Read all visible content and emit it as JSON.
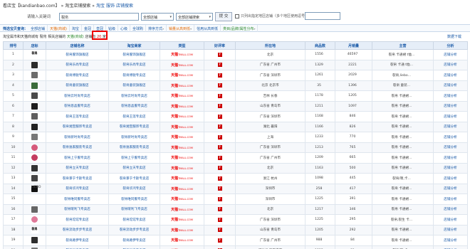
{
  "breadcrumb": {
    "items": [
      "看店宝【kandianbao.com】",
      "»",
      "淘宝店铺搜索",
      "»",
      "淘宝",
      "服饰",
      "店铺搜索"
    ]
  },
  "search": {
    "label": "请输入关键词",
    "value": "裂帛",
    "select1": "全部店铺",
    "select2": "全部店铺搜索",
    "button": "提 交",
    "checkbox_label": "只列出指定地区店铺（多个地区使用逗号 区分）"
  },
  "filter": {
    "title": "筛选宝贝查询：",
    "tabs": [
      {
        "label": "全部店铺",
        "style": "sel-tab"
      },
      {
        "label": "天猫(商城)",
        "style": "orange"
      },
      {
        "label": "淘宝",
        "style": ""
      },
      {
        "label": "金冠",
        "style": ""
      },
      {
        "label": "皇冠",
        "style": ""
      },
      {
        "label": "钻级",
        "style": ""
      },
      {
        "label": "心级",
        "style": ""
      },
      {
        "label": "全球购",
        "style": ""
      },
      {
        "label": "排序方式",
        "style": "",
        "arrow": "▾"
      },
      {
        "label": "销量从高到低",
        "style": "orange",
        "arrow": "▾"
      },
      {
        "label": "信用从高到低",
        "style": ""
      },
      {
        "label": "类目/品牌/属性分布",
        "style": "green",
        "arrow": "▾"
      }
    ]
  },
  "info": {
    "prefix": "淘宝属市和天猫商城有",
    "keyword": "裂帛",
    "mid": "相关店铺",
    "scope_prefix": "的",
    "scope": "天猫(商城)",
    "count_prefix": "店铺有",
    "count": "20",
    "count_suffix": "家"
  },
  "export_label": "数据下载",
  "table": {
    "headers": [
      "排号",
      "店标",
      "店铺名称",
      "淘宝商家",
      "类型",
      "好评率",
      "所在地",
      "商品数",
      "月销量",
      "主营",
      "分析"
    ],
    "rows": [
      {
        "no": "1",
        "logo_text": "裂帛",
        "name": "裂帛服饰旗舰店",
        "seller": "裂帛服饰旗舰店",
        "type": "天猫",
        "type_small": "TMALL.COM",
        "rate": "?",
        "loc": "北京",
        "items": "1556",
        "sales": "46597",
        "main": "裂帛 卡通裙 t恤...",
        "action": "店铺分析"
      },
      {
        "no": "2",
        "logo_text": "",
        "name": "裂帛乐尚专卖店",
        "seller": "裂帛乐尚专卖店",
        "type": "天猫",
        "type_small": "TMALL.COM",
        "rate": "?",
        "loc": "广东省 广州市",
        "items": "1329",
        "sales": "2221",
        "main": "裂帛 卡通 t恤...",
        "action": "店铺分析"
      },
      {
        "no": "3",
        "logo_text": "",
        "name": "裂帛博锐专卖店",
        "seller": "裂帛博锐专卖店",
        "type": "天猫",
        "type_small": "TMALL.COM",
        "rate": "?",
        "loc": "广东省 深圳市",
        "items": "1261",
        "sales": "2029",
        "main": "裂帛,liebo...",
        "action": "店铺分析"
      },
      {
        "no": "4",
        "logo_text": "",
        "name": "裂帛童装旗舰店",
        "seller": "裂帛童装旗舰店",
        "type": "天猫",
        "type_small": "TMALL.COM",
        "rate": "?",
        "loc": "北京 北京市",
        "items": "35",
        "sales": "1396",
        "main": "裂帛 童装...",
        "action": "店铺分析"
      },
      {
        "no": "5",
        "logo_text": "",
        "name": "裂帛云时尚专卖店",
        "seller": "裂帛云时尚专卖店",
        "type": "天猫",
        "type_small": "TMALL.COM",
        "rate": "?",
        "loc": "吉林 长春",
        "items": "1178",
        "sales": "1205",
        "main": "裂帛 卡通裙...",
        "action": "店铺分析"
      },
      {
        "no": "6",
        "logo_text": "",
        "name": "裂帛恩晶服专卖店",
        "seller": "裂帛恩晶服专卖店",
        "type": "天猫",
        "type_small": "TMALL.COM",
        "rate": "?",
        "loc": "山东省 青岛市",
        "items": "1211",
        "sales": "1097",
        "main": "裂帛 卡通裙...",
        "action": "店铺分析"
      },
      {
        "no": "7",
        "logo_text": "",
        "name": "裂帛王莲专卖店",
        "seller": "裂帛王莲专卖店",
        "type": "天猫",
        "type_small": "TMALL.COM",
        "rate": "?",
        "loc": "广东省 深圳市",
        "items": "1168",
        "sales": "846",
        "main": "裂帛 卡通裙...",
        "action": "店铺分析"
      },
      {
        "no": "8",
        "logo_text": "",
        "name": "裂帛湘宝服饰专卖店",
        "seller": "裂帛湘宝服饰专卖店",
        "type": "天猫",
        "type_small": "TMALL.COM",
        "rate": "?",
        "loc": "湖北 襄阳",
        "items": "1166",
        "sales": "826",
        "main": "裂帛 卡通裙...",
        "action": "店铺分析"
      },
      {
        "no": "9",
        "logo_text": "",
        "name": "裂帛新时尚专卖店",
        "seller": "裂帛新时尚专卖店",
        "type": "天猫",
        "type_small": "TMALL.COM",
        "rate": "?",
        "loc": "上海",
        "items": "1233",
        "sales": "770",
        "main": "裂帛 卡通裙...",
        "action": "店铺分析"
      },
      {
        "no": "10",
        "logo_text": "",
        "name": "裂帛逸家服装专卖店",
        "seller": "裂帛逸家服装专卖店",
        "type": "天猫",
        "type_small": "TMALL.COM",
        "rate": "?",
        "loc": "广东省 深圳市",
        "items": "1213",
        "sales": "765",
        "main": "裂帛 卡通裙...",
        "action": "店铺分析"
      },
      {
        "no": "11",
        "logo_text": "",
        "name": "裂帛上宁服专卖店",
        "seller": "裂帛上宁服专卖店",
        "type": "天猫",
        "type_small": "TMALL.COM",
        "rate": "?",
        "loc": "广东省 广州市",
        "items": "1209",
        "sales": "665",
        "main": "裂帛 卡通裙...",
        "action": "店铺分析"
      },
      {
        "no": "12",
        "logo_text": "",
        "name": "裂帛立天专卖店",
        "seller": "裂帛立天专卖店",
        "type": "天猫",
        "type_small": "TMALL.COM",
        "rate": "?",
        "loc": "北京",
        "items": "1163",
        "sales": "500",
        "main": "裂帛 卡通裙...",
        "action": "店铺分析"
      },
      {
        "no": "13",
        "logo_text": "",
        "name": "裂帛掌于卡斯专卖店",
        "seller": "裂帛掌于卡斯专卖店",
        "type": "天猫",
        "type_small": "TMALL.COM",
        "rate": "?",
        "loc": "浙江 杭州",
        "items": "1098",
        "sales": "445",
        "main": "裂帛/唛,卡...",
        "action": "店铺分析"
      },
      {
        "no": "14",
        "logo_text": "LIEBO",
        "name": "裂帛华鸿专卖店",
        "seller": "裂帛华鸿专卖店",
        "type": "天猫",
        "type_small": "TMALL.COM",
        "rate": "?",
        "loc": "深圳市",
        "items": "258",
        "sales": "417",
        "main": "裂帛 卡通裙...",
        "action": "店铺分析"
      },
      {
        "no": "15",
        "logo_text": "",
        "name": "裂帛唯同服专卖店",
        "seller": "裂帛唯同服专卖店",
        "type": "天猫",
        "type_small": "TMALL.COM",
        "rate": "?",
        "loc": "深圳市",
        "items": "1225",
        "sales": "391",
        "main": "裂帛 卡通裙...",
        "action": "店铺分析"
      },
      {
        "no": "16",
        "logo_text": "",
        "name": "裂帛唛利飞专卖店",
        "seller": "裂帛唛利飞专卖店",
        "type": "天猫",
        "type_small": "TMALL.COM",
        "rate": "?",
        "loc": "北京",
        "items": "1217",
        "sales": "346",
        "main": "裂帛 卡通裙...",
        "action": "店铺分析"
      },
      {
        "no": "17",
        "logo_text": "",
        "name": "裂帛馆馆专卖店",
        "seller": "裂帛馆馆专卖店",
        "type": "天猫",
        "type_small": "TMALL.COM",
        "rate": "?",
        "loc": "广东省 深圳市",
        "items": "1225",
        "sales": "295",
        "main": "裂帛,裂生 卡...",
        "action": "店铺分析"
      },
      {
        "no": "18",
        "logo_text": "裂帛",
        "name": "裂帛流动步步专卖店",
        "seller": "裂帛流动步步专卖店",
        "type": "天猫",
        "type_small": "TMALL.COM",
        "rate": "?",
        "loc": "山东省 青岛市",
        "items": "1205",
        "sales": "292",
        "main": "裂帛 卡通裙...",
        "action": "店铺分析"
      },
      {
        "no": "19",
        "logo_text": "",
        "name": "裂帛路伊专卖店",
        "seller": "裂帛路伊专卖店",
        "type": "天猫",
        "type_small": "TMALL.COM",
        "rate": "?",
        "loc": "广东省 广州市",
        "items": "988",
        "sales": "84",
        "main": "裂帛 卡通裙...",
        "action": "店铺分析"
      },
      {
        "no": "20",
        "logo_text": "",
        "name": "裂帛恒素专卖店",
        "seller": "裂帛恒素专卖店",
        "type": "天猫",
        "type_small": "TMALL.COM",
        "rate": "?",
        "loc": "河北省 石家庄市",
        "items": "1225",
        "sales": "31",
        "main": "裂帛/唛,卡...",
        "action": "店铺分析"
      }
    ]
  }
}
